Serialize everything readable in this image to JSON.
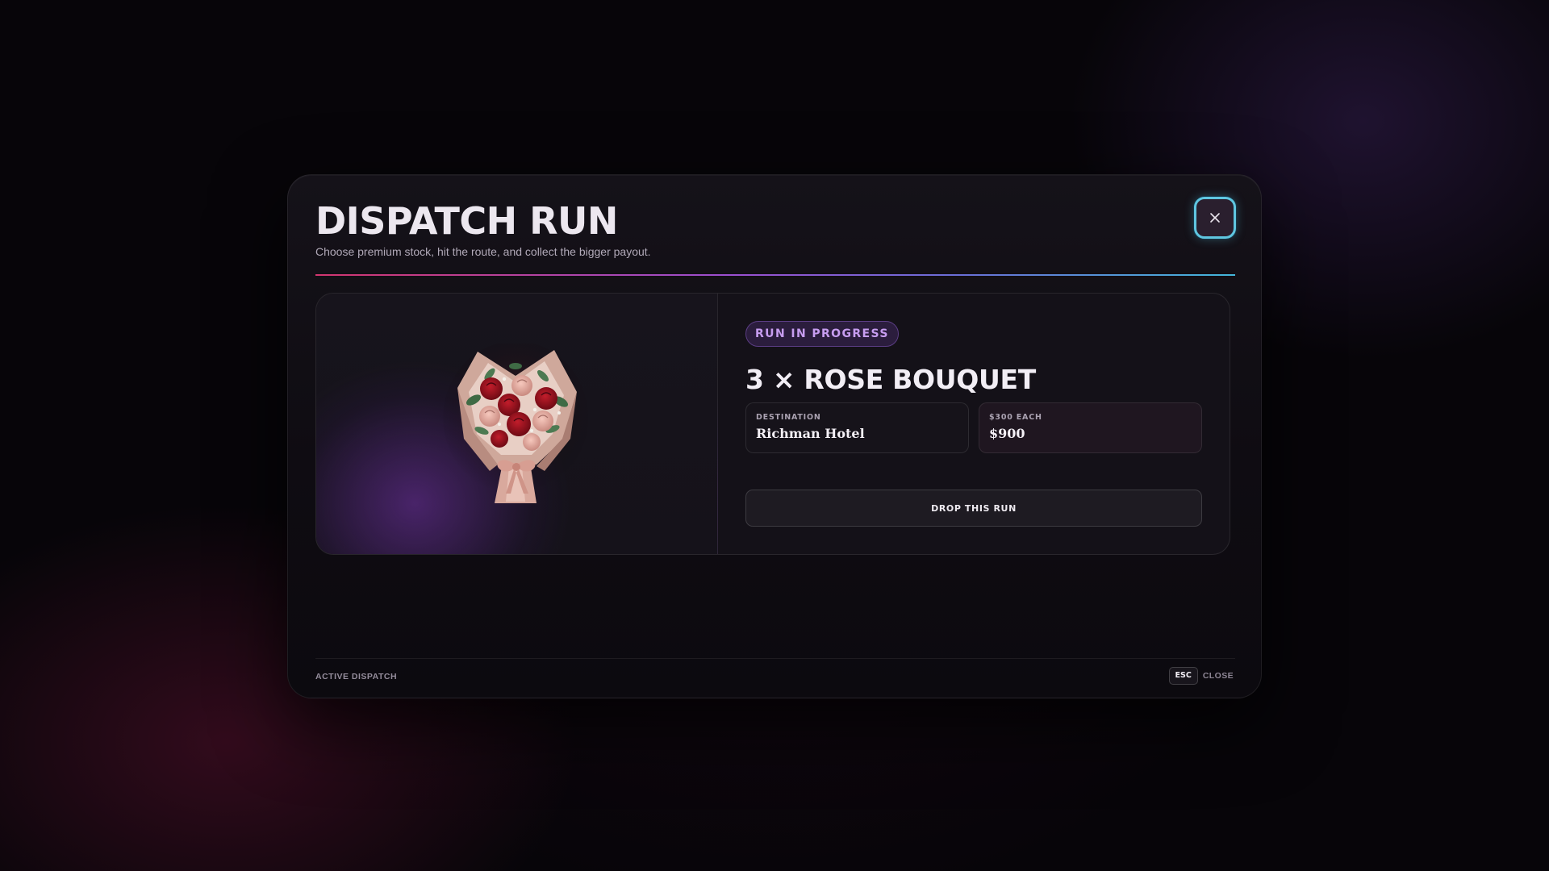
{
  "modal": {
    "title": "DISPATCH RUN",
    "subtitle": "Choose premium stock, hit the route, and collect the bigger payout.",
    "close_icon": "close-icon"
  },
  "run": {
    "status": "RUN IN PROGRESS",
    "item_title": "3 × ROSE BOUQUET",
    "image": "rose-bouquet",
    "destination": {
      "label": "DESTINATION",
      "value": "Richman Hotel"
    },
    "payout": {
      "label": "$300 EACH",
      "value": "$900"
    },
    "drop_button": "DROP THIS RUN"
  },
  "footer": {
    "left": "ACTIVE DISPATCH",
    "key": "ESC",
    "key_label": "CLOSE"
  },
  "colors": {
    "accent_cyan": "#5fc6e0",
    "accent_purple": "#c79df0",
    "gradient_start": "#d2366f",
    "gradient_end": "#43b7da"
  }
}
